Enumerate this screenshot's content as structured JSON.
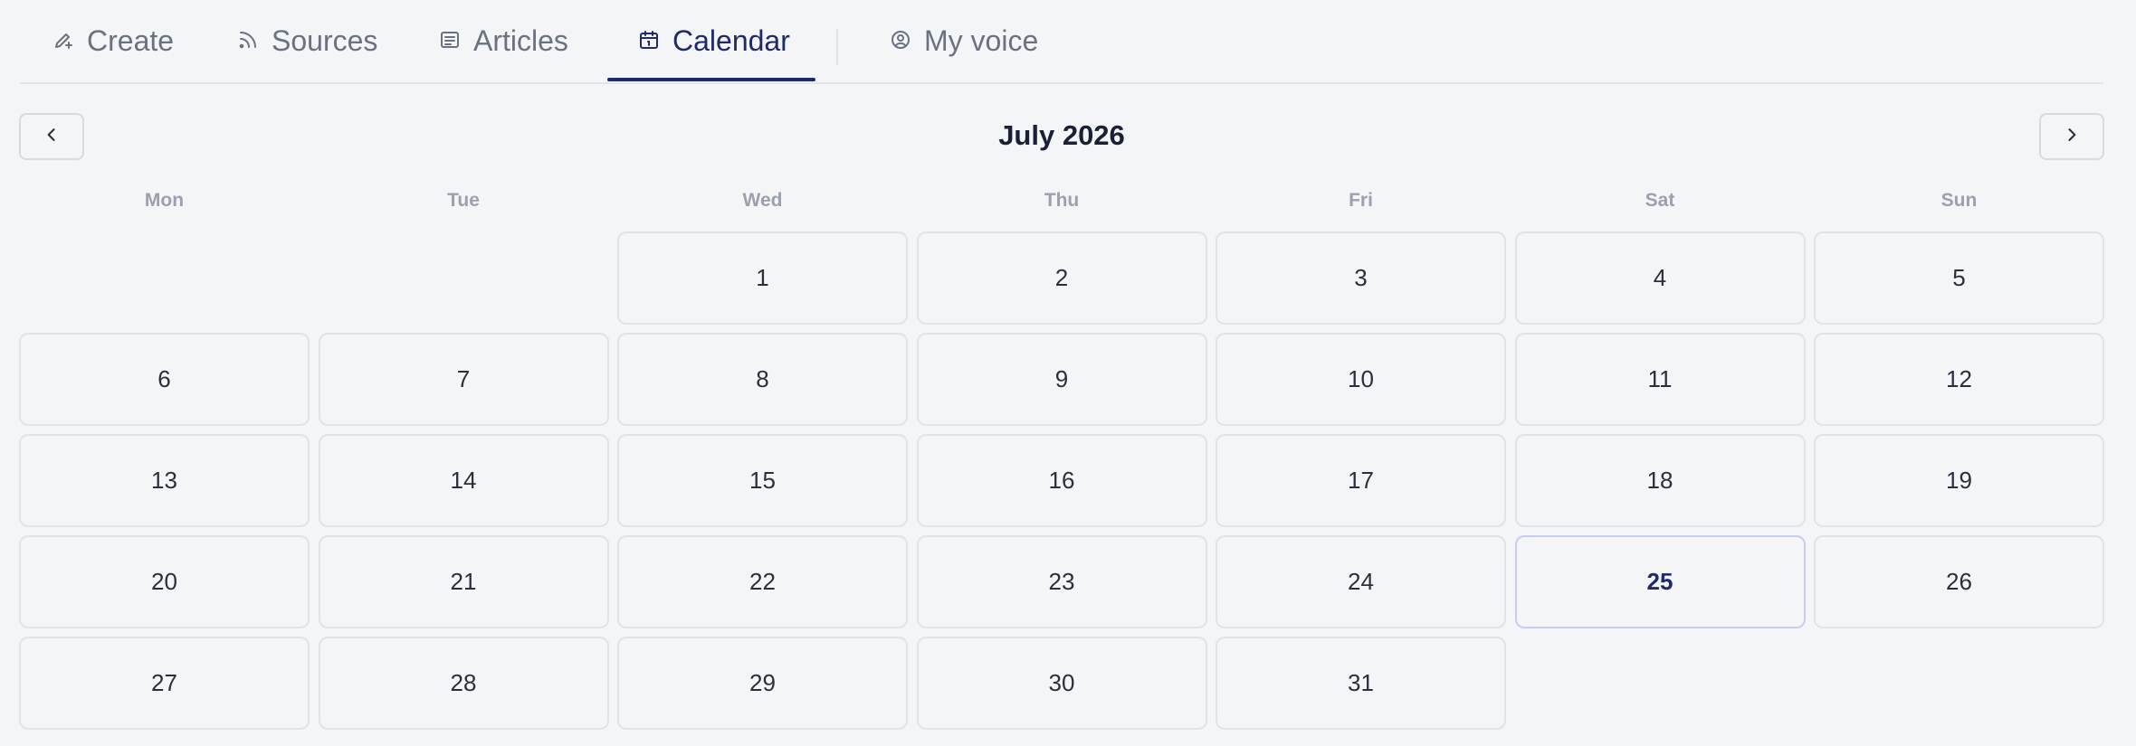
{
  "tabs": [
    {
      "label": "Create",
      "icon": "pencil-plus-icon",
      "active": false
    },
    {
      "label": "Sources",
      "icon": "rss-icon",
      "active": false
    },
    {
      "label": "Articles",
      "icon": "list-icon",
      "active": false
    },
    {
      "label": "Calendar",
      "icon": "calendar-icon",
      "active": true
    },
    {
      "label": "My voice",
      "icon": "user-circle-icon",
      "active": false
    }
  ],
  "calendar": {
    "month_label": "July 2026",
    "prev_icon": "chevron-left-icon",
    "next_icon": "chevron-right-icon",
    "weekdays": [
      "Mon",
      "Tue",
      "Wed",
      "Thu",
      "Fri",
      "Sat",
      "Sun"
    ],
    "leading_blank_days": 2,
    "days": [
      "1",
      "2",
      "3",
      "4",
      "5",
      "6",
      "7",
      "8",
      "9",
      "10",
      "11",
      "12",
      "13",
      "14",
      "15",
      "16",
      "17",
      "18",
      "19",
      "20",
      "21",
      "22",
      "23",
      "24",
      "25",
      "26",
      "27",
      "28",
      "29",
      "30",
      "31"
    ],
    "today": "25"
  },
  "colors": {
    "background": "#f4f5f7",
    "accent": "#1e2a6b",
    "today_border": "#c5cdf3",
    "muted_text": "#6a7181"
  }
}
